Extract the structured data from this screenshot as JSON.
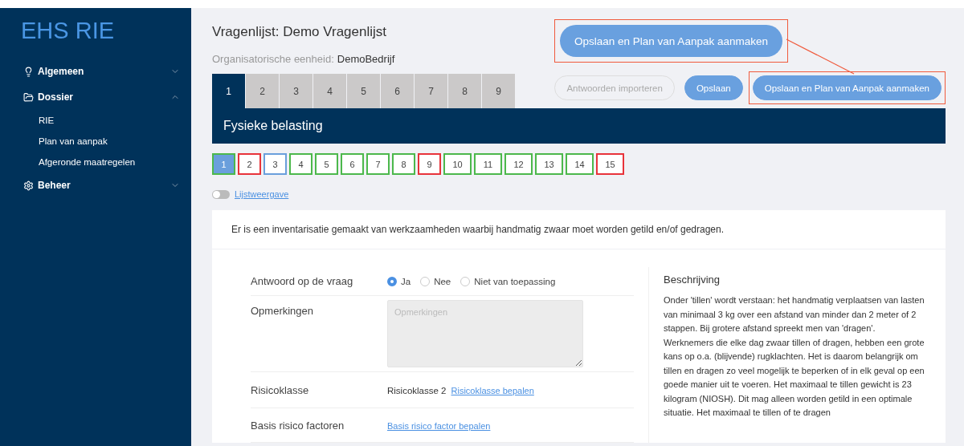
{
  "sidebar": {
    "logo": "EHS RIE",
    "items": [
      {
        "label": "Algemeen",
        "kind": "bulb",
        "expanded": false
      },
      {
        "label": "Dossier",
        "kind": "folder",
        "expanded": true,
        "children": [
          {
            "label": "RIE"
          },
          {
            "label": "Plan van aanpak"
          },
          {
            "label": "Afgeronde maatregelen"
          }
        ]
      },
      {
        "label": "Beheer",
        "kind": "gear",
        "expanded": false
      }
    ]
  },
  "header": {
    "title": "Vragenlijst: Demo Vragenlijst",
    "org_label": "Organisatorische eenheid:",
    "org_value": "DemoBedrijf"
  },
  "annotation": {
    "callout_button": "Opslaan en Plan van Aanpak aanmaken"
  },
  "tabs": [
    {
      "label": "1",
      "selected": true
    },
    {
      "label": "2",
      "selected": false
    },
    {
      "label": "3",
      "selected": false
    },
    {
      "label": "4",
      "selected": false
    },
    {
      "label": "5",
      "selected": false
    },
    {
      "label": "6",
      "selected": false
    },
    {
      "label": "7",
      "selected": false
    },
    {
      "label": "8",
      "selected": false
    },
    {
      "label": "9",
      "selected": false
    }
  ],
  "buttons": [
    {
      "label": "Antwoorden importeren",
      "disabled": true,
      "highlighted": false
    },
    {
      "label": "Opslaan",
      "disabled": false,
      "highlighted": false
    },
    {
      "label": "Opslaan en Plan van Aanpak aanmaken",
      "disabled": false,
      "highlighted": true
    }
  ],
  "section_title": "Fysieke belasting",
  "questions": [
    {
      "label": "1",
      "selected": true,
      "color": "#4cb84c"
    },
    {
      "label": "2",
      "selected": false,
      "color": "#e8333a"
    },
    {
      "label": "3",
      "selected": false,
      "color": "#6a9fdc"
    },
    {
      "label": "4",
      "selected": false,
      "color": "#4cb84c"
    },
    {
      "label": "5",
      "selected": false,
      "color": "#4cb84c"
    },
    {
      "label": "6",
      "selected": false,
      "color": "#4cb84c"
    },
    {
      "label": "7",
      "selected": false,
      "color": "#4cb84c"
    },
    {
      "label": "8",
      "selected": false,
      "color": "#4cb84c"
    },
    {
      "label": "9",
      "selected": false,
      "color": "#e8333a"
    },
    {
      "label": "10",
      "selected": false,
      "color": "#4cb84c"
    },
    {
      "label": "11",
      "selected": false,
      "color": "#4cb84c"
    },
    {
      "label": "12",
      "selected": false,
      "color": "#4cb84c"
    },
    {
      "label": "13",
      "selected": false,
      "color": "#4cb84c"
    },
    {
      "label": "14",
      "selected": false,
      "color": "#4cb84c"
    },
    {
      "label": "15",
      "selected": false,
      "color": "#e8333a"
    }
  ],
  "list_view": {
    "label": "Lijstweergave",
    "on": false
  },
  "question_text": "Er is een inventarisatie gemaakt van werkzaamheden waarbij handmatig zwaar moet worden getild en/of gedragen.",
  "form": {
    "answer": {
      "label": "Antwoord op de vraag",
      "options": [
        {
          "label": "Ja",
          "selected": true
        },
        {
          "label": "Nee",
          "selected": false
        },
        {
          "label": "Niet van toepassing",
          "selected": false
        }
      ]
    },
    "remarks": {
      "label": "Opmerkingen",
      "placeholder": "Opmerkingen"
    },
    "risk_class": {
      "label": "Risicoklasse",
      "value": "Risicoklasse 2",
      "link": "Risicoklasse bepalen"
    },
    "base_factors": {
      "label": "Basis risico factoren",
      "link": "Basis risico factor bepalen"
    }
  },
  "description": {
    "title": "Beschrijving",
    "text": "Onder 'tillen' wordt verstaan: het handmatig verplaatsen van lasten van minimaal 3 kg over een afstand van minder dan 2 meter of 2 stappen. Bij grotere afstand spreekt men van 'dragen'. Werknemers die elke dag zwaar tillen of dragen, hebben een grote kans op o.a. (blijvende) rugklachten. Het is daarom belangrijk om tillen en dragen zo veel mogelijk te beperken of in elk geval op een goede manier uit te voeren. Het maximaal te tillen gewicht is 23 kilogram (NIOSH). Dit mag alleen worden getild in een optimale situatie. Het maximaal te tillen of te dragen"
  }
}
